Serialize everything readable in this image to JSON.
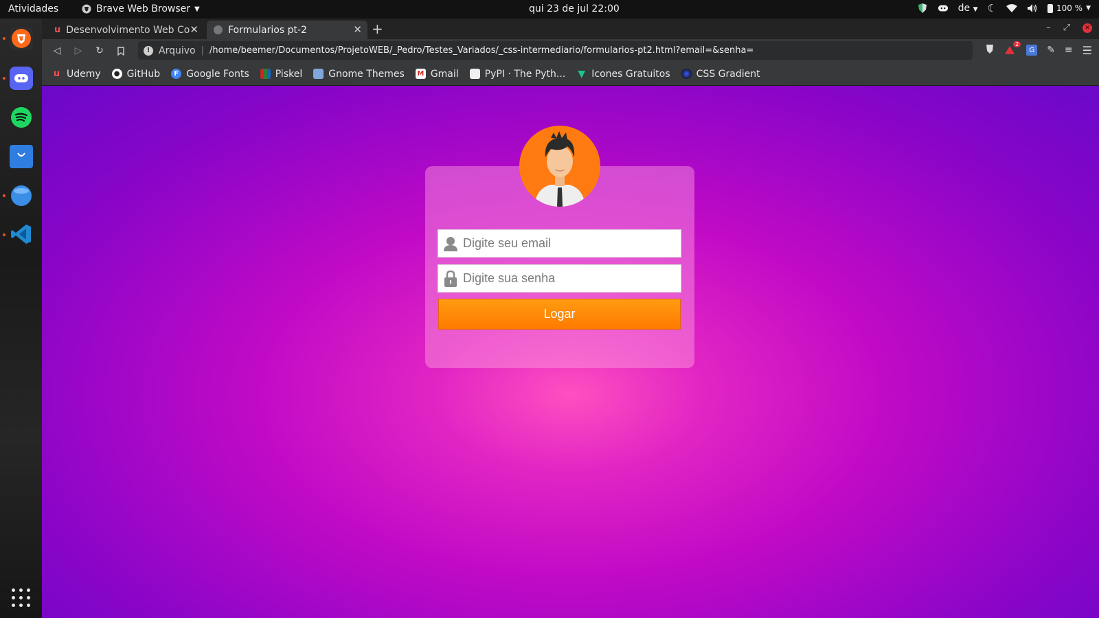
{
  "topbar": {
    "activities": "Atividades",
    "app_name": "Brave Web Browser",
    "clock": "qui 23 de jul  22:00",
    "keyboard_layout": "de",
    "battery": "100 %"
  },
  "browser": {
    "tabs": [
      {
        "title": "Desenvolvimento Web Com",
        "favicon": "udemy-icon",
        "active": false
      },
      {
        "title": "Formularios pt-2",
        "favicon": "globe-icon",
        "active": true
      }
    ],
    "address": {
      "scheme_label": "Arquivo",
      "url": "/home/beemer/Documentos/ProjetoWEB/_Pedro/Testes_Variados/_css-intermediario/formularios-pt2.html?email=&senha="
    },
    "shields_badge": "2",
    "bookmarks": [
      {
        "label": "Udemy",
        "icon": "udemy-icon",
        "color": "#ec5252"
      },
      {
        "label": "GitHub",
        "icon": "github-icon",
        "color": "#ffffff"
      },
      {
        "label": "Google Fonts",
        "icon": "google-fonts-icon",
        "color": "#4285f4"
      },
      {
        "label": "Piskel",
        "icon": "piskel-icon",
        "color": "#2e7d32"
      },
      {
        "label": "Gnome Themes",
        "icon": "gnome-themes-icon",
        "color": "#7fa7d9"
      },
      {
        "label": "Gmail",
        "icon": "gmail-icon",
        "color": "#d93025"
      },
      {
        "label": "PyPI · The Pyth...",
        "icon": "pypi-icon",
        "color": "#f0f0f0"
      },
      {
        "label": "Icones Gratuitos",
        "icon": "flaticon-icon",
        "color": "#1bc48c"
      },
      {
        "label": "CSS Gradient",
        "icon": "css-gradient-icon",
        "color": "#2e3bd0"
      }
    ]
  },
  "login": {
    "email_placeholder": "Digite seu email",
    "password_placeholder": "Digite sua senha",
    "submit_label": "Logar"
  },
  "colors": {
    "button": "#ff8a00",
    "avatar_bg": "#ff7a10",
    "page_center": "#ff4fc0",
    "page_edge": "#6a08c9"
  }
}
